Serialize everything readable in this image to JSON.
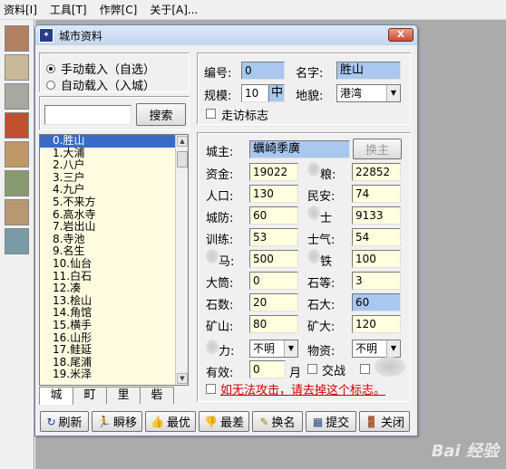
{
  "menu": [
    "资料[I]",
    "工具[T]",
    "作弊[C]",
    "关于[A]..."
  ],
  "window": {
    "title": "城市资料",
    "close": "X"
  },
  "mode": {
    "manual": "手动载入（自选）",
    "auto": "自动载入（入城）",
    "selected": "manual"
  },
  "search": {
    "value": "",
    "button": "搜索"
  },
  "cities": [
    "0.胜山",
    "1.大浦",
    "2.八户",
    "3.三户",
    "4.九户",
    "5.不来方",
    "6.高水寺",
    "7.岩出山",
    "8.寺池",
    "9.名生",
    "10.仙台",
    "11.白石",
    "12.凑",
    "13.桧山",
    "14.角馆",
    "15.横手",
    "16.山形",
    "17.鲑延",
    "18.尾浦",
    "19.米泽"
  ],
  "selected_city_index": 0,
  "tabs": [
    "城",
    "町",
    "里",
    "砦"
  ],
  "active_tab": "城",
  "info": {
    "id_label": "编号:",
    "id": "0",
    "name_label": "名字:",
    "name": "胜山",
    "scale_label": "规模:",
    "scale": "10",
    "scale_unit": "中",
    "terrain_label": "地貌:",
    "terrain": "港湾",
    "visit_label": "走访标志"
  },
  "lord": {
    "label": "城主:",
    "value": "蠣崎季廣",
    "change_button": "换主"
  },
  "stats": {
    "funds_label": "资金:",
    "funds": "19022",
    "food_label": "粮:",
    "food": "22852",
    "pop_label": "人口:",
    "pop": "130",
    "order_label": "民安:",
    "order": "74",
    "defense_label": "城防:",
    "defense": "60",
    "soldier_label": "士",
    "soldier": "9133",
    "training_label": "训练:",
    "training": "53",
    "morale_label": "士气:",
    "morale": "54",
    "horse_label": "马:",
    "horse": "500",
    "gun_label": "铁",
    "gun": "100",
    "tube_label": "大筒:",
    "tube": "0",
    "stone_grade_label": "石等:",
    "stone_grade": "3",
    "stone_count_label": "石数:",
    "stone_count": "20",
    "stone_max_label": "石大:",
    "stone_max": "60",
    "mine_label": "矿山:",
    "mine": "80",
    "mine_max_label": "矿大:",
    "mine_max": "120",
    "power_label": "力:",
    "power": "不明",
    "goods_label": "物资:",
    "goods": "不明",
    "valid_label": "有效:",
    "valid": "0",
    "valid_unit": "月",
    "trade_label": "交战"
  },
  "warning": "如无法攻击，请去掉这个标志。",
  "buttons": [
    "刷新",
    "瞬移",
    "最优",
    "最差",
    "换名",
    "提交",
    "关闭"
  ],
  "watermark": "Bai 经验"
}
